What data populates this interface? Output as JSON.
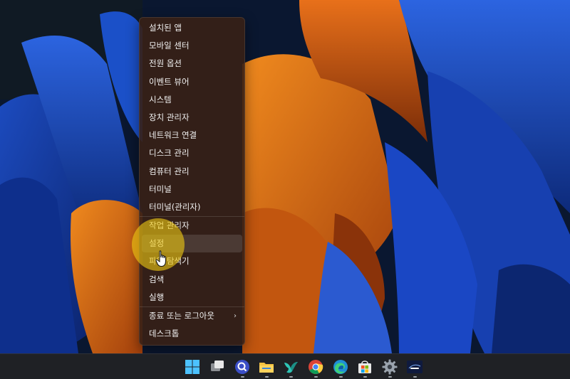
{
  "context_menu": {
    "items": [
      {
        "label": "설치된 앱"
      },
      {
        "label": "모바일 센터"
      },
      {
        "label": "전원 옵션"
      },
      {
        "label": "이벤트 뷰어"
      },
      {
        "label": "시스템"
      },
      {
        "label": "장치 관리자"
      },
      {
        "label": "네트워크 연결"
      },
      {
        "label": "디스크 관리"
      },
      {
        "label": "컴퓨터 관리"
      },
      {
        "label": "터미널"
      },
      {
        "label": "터미널(관리자)"
      },
      {
        "label": "작업 관리자"
      },
      {
        "label": "설정"
      },
      {
        "label": "파일 탐색기"
      },
      {
        "label": "검색"
      },
      {
        "label": "실행"
      },
      {
        "label": "종료 또는 로그아웃",
        "submenu_icon": "chevron-right-icon"
      },
      {
        "label": "데스크톱"
      }
    ],
    "highlighted_item": "설정"
  },
  "taskbar": {
    "icons": [
      {
        "name": "start-icon",
        "running": false
      },
      {
        "name": "task-view-icon",
        "running": false
      },
      {
        "name": "zoom-search-app-icon",
        "running": true
      },
      {
        "name": "file-explorer-icon",
        "running": true
      },
      {
        "name": "bird-app-icon",
        "running": true
      },
      {
        "name": "chrome-icon",
        "running": true
      },
      {
        "name": "edge-icon",
        "running": true
      },
      {
        "name": "microsoft-store-icon",
        "running": true
      },
      {
        "name": "settings-gear-icon",
        "running": true
      },
      {
        "name": "disney-plus-icon",
        "running": true
      }
    ]
  },
  "colors": {
    "menu_background": "#37201680",
    "cursor_highlight": "#eec814",
    "taskbar": "#1f2125"
  }
}
